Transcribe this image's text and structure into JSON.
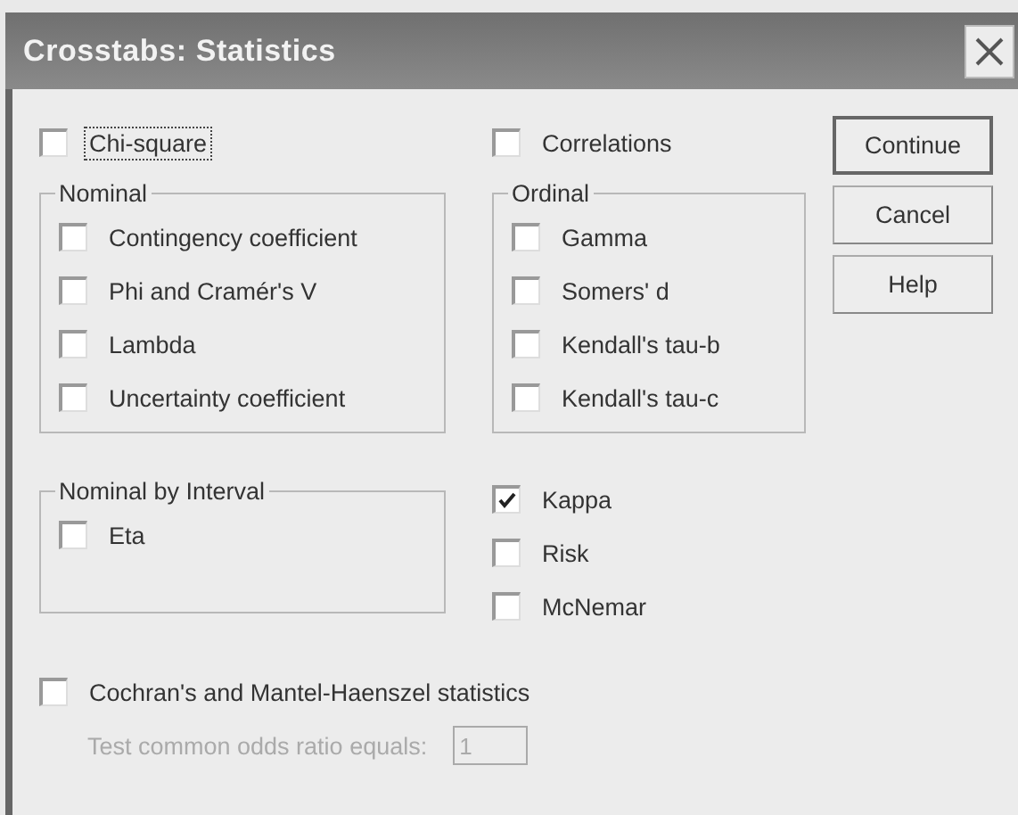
{
  "window": {
    "title": "Crosstabs: Statistics"
  },
  "chi_square": {
    "label": "Chi-square",
    "checked": false,
    "focused": true
  },
  "correlations": {
    "label": "Correlations",
    "checked": false
  },
  "nominal": {
    "title": "Nominal",
    "items": [
      {
        "label": "Contingency coefficient",
        "checked": false
      },
      {
        "label": "Phi and Cramér's V",
        "checked": false
      },
      {
        "label": "Lambda",
        "checked": false
      },
      {
        "label": "Uncertainty coefficient",
        "checked": false
      }
    ]
  },
  "ordinal": {
    "title": "Ordinal",
    "items": [
      {
        "label": "Gamma",
        "checked": false
      },
      {
        "label": "Somers' d",
        "checked": false
      },
      {
        "label": "Kendall's tau-b",
        "checked": false
      },
      {
        "label": "Kendall's tau-c",
        "checked": false
      }
    ]
  },
  "nominal_by_interval": {
    "title": "Nominal by Interval",
    "items": [
      {
        "label": "Eta",
        "checked": false
      }
    ]
  },
  "agreement_items": [
    {
      "label": "Kappa",
      "checked": true
    },
    {
      "label": "Risk",
      "checked": false
    },
    {
      "label": "McNemar",
      "checked": false
    }
  ],
  "cochran": {
    "label": "Cochran's and Mantel-Haenszel statistics",
    "checked": false
  },
  "odds_ratio": {
    "label": "Test common odds ratio equals:",
    "value": "1",
    "disabled": true
  },
  "buttons": [
    {
      "label": "Continue",
      "default": true
    },
    {
      "label": "Cancel",
      "default": false
    },
    {
      "label": "Help",
      "default": false
    }
  ]
}
